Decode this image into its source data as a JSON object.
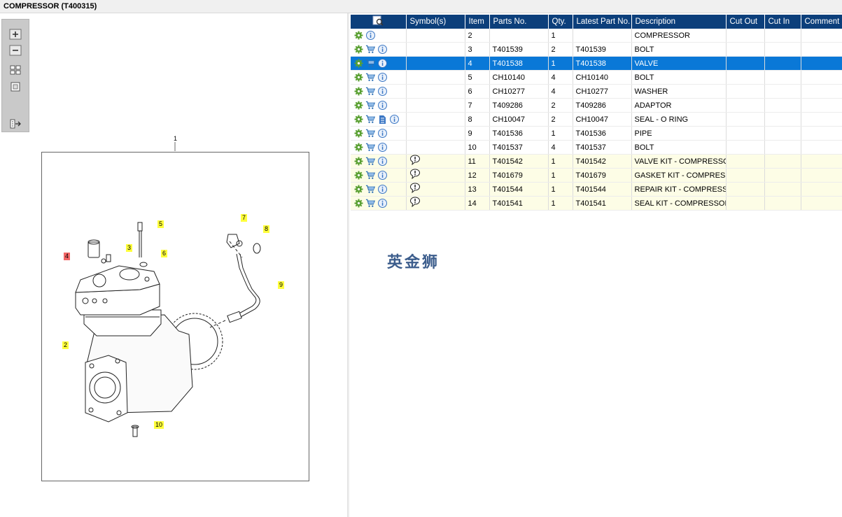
{
  "window": {
    "title": "COMPRESSOR (T400315)"
  },
  "diagram": {
    "top_label": "1",
    "callouts": [
      "2",
      "3",
      "4",
      "5",
      "6",
      "7",
      "8",
      "9",
      "10"
    ]
  },
  "watermark": "英金狮",
  "toolbox": {
    "buttons": [
      "zoom-in",
      "zoom-out",
      "fit-all",
      "actual-size",
      "export"
    ]
  },
  "table": {
    "columns": [
      "",
      "Symbol(s)",
      "Item",
      "Parts No.",
      "Qty.",
      "Latest Part No.",
      "Description",
      "Cut Out",
      "Cut In",
      "Comment"
    ],
    "rows": [
      {
        "item": "2",
        "parts": "",
        "qty": "1",
        "latest": "",
        "desc": "COMPRESSOR",
        "cart": false,
        "doc": false,
        "symbol": false,
        "type": "normal"
      },
      {
        "item": "3",
        "parts": "T401539",
        "qty": "2",
        "latest": "T401539",
        "desc": "BOLT",
        "cart": true,
        "doc": false,
        "symbol": false,
        "type": "normal"
      },
      {
        "item": "4",
        "parts": "T401538",
        "qty": "1",
        "latest": "T401538",
        "desc": "VALVE",
        "cart": true,
        "doc": false,
        "symbol": false,
        "type": "selected"
      },
      {
        "item": "5",
        "parts": "CH10140",
        "qty": "4",
        "latest": "CH10140",
        "desc": "BOLT",
        "cart": true,
        "doc": false,
        "symbol": false,
        "type": "normal"
      },
      {
        "item": "6",
        "parts": "CH10277",
        "qty": "4",
        "latest": "CH10277",
        "desc": "WASHER",
        "cart": true,
        "doc": false,
        "symbol": false,
        "type": "normal"
      },
      {
        "item": "7",
        "parts": "T409286",
        "qty": "2",
        "latest": "T409286",
        "desc": "ADAPTOR",
        "cart": true,
        "doc": false,
        "symbol": false,
        "type": "normal"
      },
      {
        "item": "8",
        "parts": "CH10047",
        "qty": "2",
        "latest": "CH10047",
        "desc": "SEAL - O RING",
        "cart": true,
        "doc": true,
        "symbol": false,
        "type": "normal"
      },
      {
        "item": "9",
        "parts": "T401536",
        "qty": "1",
        "latest": "T401536",
        "desc": "PIPE",
        "cart": true,
        "doc": false,
        "symbol": false,
        "type": "normal"
      },
      {
        "item": "10",
        "parts": "T401537",
        "qty": "4",
        "latest": "T401537",
        "desc": "BOLT",
        "cart": true,
        "doc": false,
        "symbol": false,
        "type": "normal"
      },
      {
        "item": "11",
        "parts": "T401542",
        "qty": "1",
        "latest": "T401542",
        "desc": "VALVE KIT - COMPRESSOR",
        "cart": true,
        "doc": false,
        "symbol": true,
        "type": "kit"
      },
      {
        "item": "12",
        "parts": "T401679",
        "qty": "1",
        "latest": "T401679",
        "desc": "GASKET KIT - COMPRESSOR",
        "cart": true,
        "doc": false,
        "symbol": true,
        "type": "kit"
      },
      {
        "item": "13",
        "parts": "T401544",
        "qty": "1",
        "latest": "T401544",
        "desc": "REPAIR KIT - COMPRESSOR",
        "cart": true,
        "doc": false,
        "symbol": true,
        "type": "kit"
      },
      {
        "item": "14",
        "parts": "T401541",
        "qty": "1",
        "latest": "T401541",
        "desc": "SEAL KIT - COMPRESSOR",
        "cart": true,
        "doc": false,
        "symbol": true,
        "type": "kit"
      }
    ]
  },
  "colors": {
    "header_bg": "#0c3f7b",
    "selected_row": "#0a78d7",
    "kit_row": "#fdfde6",
    "callout_yellow": "#ffff3c",
    "callout_red": "#f26666",
    "gear_green": "#5aa032"
  }
}
